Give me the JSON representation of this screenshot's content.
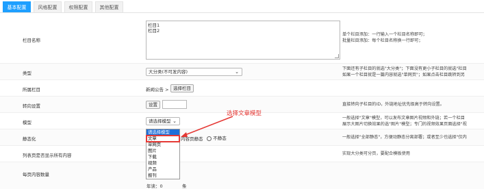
{
  "tabs": [
    "基本配置",
    "风格配置",
    "权限配置",
    "其他配置"
  ],
  "rows": {
    "name": {
      "label": "栏目名称",
      "value_lines": [
        "栏目1",
        "栏目2"
      ],
      "help": [
        "单个栏目添加：一行输入一个栏目名称即可；",
        "批量栏目添加：每个栏目名称换一行即可；"
      ]
    },
    "type": {
      "label": "类型",
      "selected": "大分类(不可发内容)",
      "help": [
        "下面还有子栏目的就选\"大分类\"；下面没有更小子栏目的就选\"栏目",
        "如果一个栏目就是一篇内容就选\"单网页\"；如果点击栏目跳转到另"
      ]
    },
    "parent": {
      "label": "所属栏目",
      "value": "新闻公告 >",
      "button": "选择栏目"
    },
    "redirect": {
      "label": "转向设置",
      "button": "设置",
      "help": "直接转向子栏目的ID，外链地址优先级高于转向设置。"
    },
    "model": {
      "label": "模型",
      "selected": "请选择模型",
      "help": [
        "一般选择\"文章\"模型，可以发布文章图片视频和外链；若一个栏目",
        "展示大图片切换效果的选\"图片\"模型；专门的视频效果页面选择\"视"
      ]
    },
    "static": {
      "label": "静态化",
      "options_text": "内容页静态",
      "option2": "不静态",
      "help": "一般选择\"全部静态\"，方便动静态分离部署；或者至少也选择\"仅内"
    },
    "list_all": {
      "label": "列表页是否显示所有内容",
      "help": "实现大分类可分页，要配合模板使用"
    },
    "per_page": {
      "label": "每页内容数量",
      "suffix": "条",
      "partial": "年读：0"
    }
  },
  "dropdown": {
    "items": [
      "请选择模型",
      "文章",
      "单网页",
      "图片",
      "下载",
      "视频",
      "产品",
      "报刊"
    ],
    "highlighted": 0,
    "marked": 1
  },
  "annotation": "选择文章模型",
  "colors": {
    "accent": "#1e9fff",
    "annotation": "#e53935",
    "highlight": "#1e6fd9"
  }
}
